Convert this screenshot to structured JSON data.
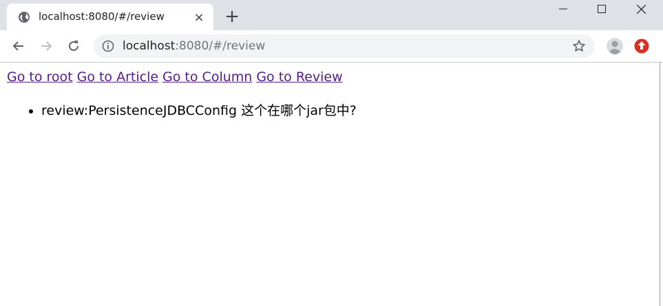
{
  "browser": {
    "tab": {
      "title": "localhost:8080/#/review",
      "favicon": "globe-icon",
      "close": "×"
    },
    "new_tab": "+",
    "address": {
      "host": "localhost",
      "rest": ":8080/#/review"
    }
  },
  "nav": {
    "links": [
      "Go to root",
      "Go to Article",
      "Go to Column",
      "Go to Review"
    ]
  },
  "review": {
    "items": [
      "review:PersistenceJDBCConfig 这个在哪个jar包中?"
    ]
  },
  "colors": {
    "tabstrip": "#dee1e6",
    "link_visited": "#551a8b",
    "extension_badge": "#d93025"
  }
}
